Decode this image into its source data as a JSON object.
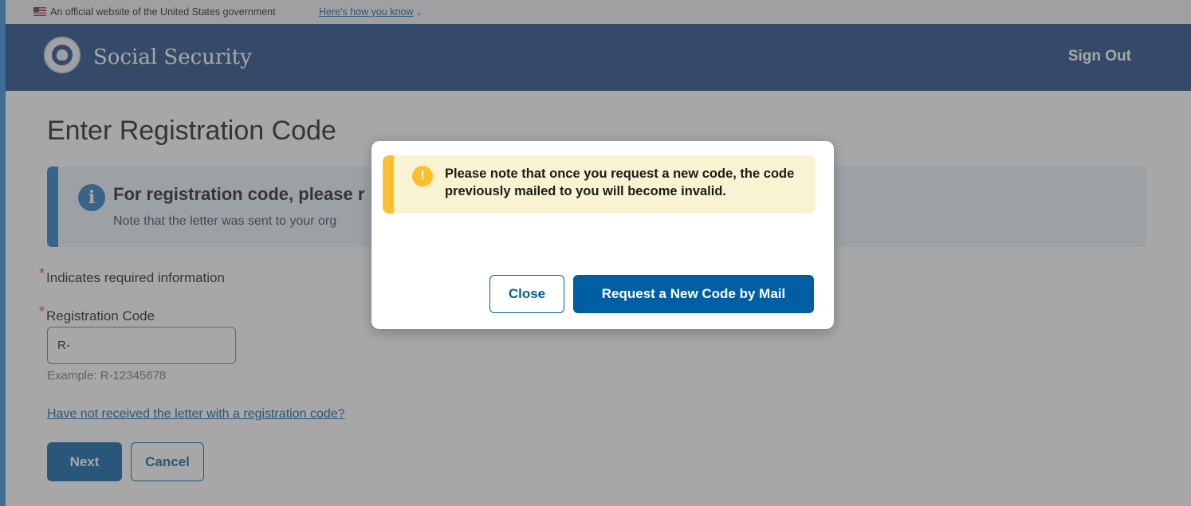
{
  "gov_banner": {
    "text": "An official website of the United States government",
    "link": "Here's how you know",
    "chevron_icon": "chevron-down-icon"
  },
  "header": {
    "brand": "Social Security",
    "sign_out": "Sign Out",
    "colors": {
      "header_bg": "#1a4480"
    }
  },
  "main": {
    "title": "Enter Registration Code",
    "info": {
      "heading": "For registration code, please r",
      "text": "Note that the letter was sent to your org",
      "icon": "info-icon"
    },
    "required_star": "*",
    "required_note": "Indicates required information",
    "field_label": "Registration Code",
    "field_value": "R-",
    "example": "Example: R-12345678",
    "no_letter_link": "Have not received the letter with a registration code?",
    "next": "Next",
    "cancel": "Cancel"
  },
  "modal": {
    "alert_icon": "warning-icon",
    "alert_text": "Please note that once you request a new code, the code previously mailed to you will become invalid.",
    "close": "Close",
    "request": "Request a New Code by Mail",
    "colors": {
      "alert_bg": "#faf3d1",
      "alert_accent": "#ffbe2e",
      "primary": "#005ea2"
    }
  }
}
